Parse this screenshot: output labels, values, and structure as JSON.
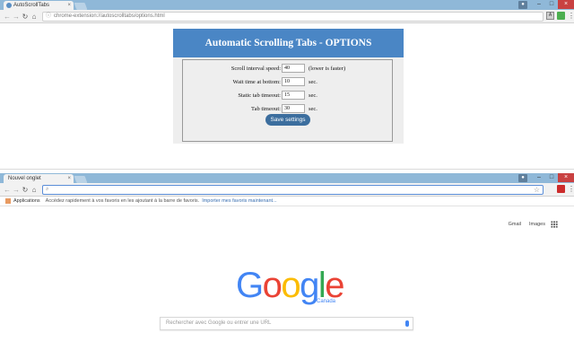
{
  "top_window": {
    "tab_title": "AutoScrollTabs",
    "url": "chrome-extension://autoscrolltabs/options.html",
    "options": {
      "header": "Automatic Scrolling Tabs - OPTIONS",
      "rows": [
        {
          "label": "Scroll interval speed:",
          "value": "40",
          "unit": "(lower is faster)"
        },
        {
          "label": "Wait time at bottom:",
          "value": "10",
          "unit": "sec."
        },
        {
          "label": "Static tab timeout:",
          "value": "15",
          "unit": "sec."
        },
        {
          "label": "Tab timeout:",
          "value": "30",
          "unit": "sec."
        }
      ],
      "save_label": "Save settings"
    }
  },
  "bottom_window": {
    "tab_title": "Nouvel onglet",
    "url": "",
    "bookmarks": {
      "apps_label": "Applications",
      "message": "Accédez rapidement à vos favoris en les ajoutant à la barre de favoris.",
      "import_link": "Importer mes favoris maintenant..."
    },
    "ntp": {
      "gmail": "Gmail",
      "images": "Images",
      "logo_letters": [
        "G",
        "o",
        "o",
        "g",
        "l",
        "e"
      ],
      "logo_colors": [
        "#4285f4",
        "#ea4335",
        "#fbbc05",
        "#4285f4",
        "#34a853",
        "#ea4335"
      ],
      "region": "Canada",
      "search_placeholder": "Rechercher avec Google ou entrer une URL"
    }
  },
  "icons": {
    "back": "←",
    "forward": "→",
    "reload": "↻",
    "home": "⌂",
    "close": "×",
    "minimize": "–",
    "maximize": "□",
    "star": "☆",
    "menu": "⋮",
    "search": "🔍"
  }
}
